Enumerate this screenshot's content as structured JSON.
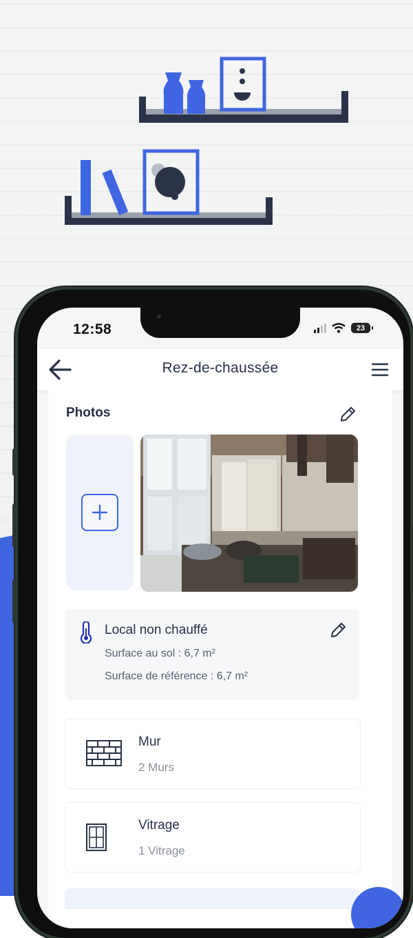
{
  "colors": {
    "accent": "#3f66e0",
    "navy": "#263145",
    "shelf_dark": "#2b3349",
    "shelf_grey": "#9aa0ad"
  },
  "status_bar": {
    "time": "12:58",
    "battery": "23",
    "icons": [
      "signal-icon",
      "wifi-icon",
      "battery-icon"
    ]
  },
  "header": {
    "title": "Rez-de-chaussée",
    "back_icon": "arrow-left-icon",
    "menu_icon": "hamburger-menu-icon"
  },
  "photos": {
    "title": "Photos",
    "edit_icon": "pencil-icon",
    "add_icon": "plus-icon"
  },
  "heating": {
    "icon": "thermometer-icon",
    "title": "Local non chauffé",
    "floor_area": "Surface au sol : 6,7 m²",
    "reference_area": "Surface de référence : 6,7 m²",
    "edit_icon": "pencil-icon"
  },
  "elements": [
    {
      "icon": "brick-wall-icon",
      "title": "Mur",
      "subtitle": "2 Murs"
    },
    {
      "icon": "window-icon",
      "title": "Vitrage",
      "subtitle": "1 Vitrage"
    }
  ]
}
